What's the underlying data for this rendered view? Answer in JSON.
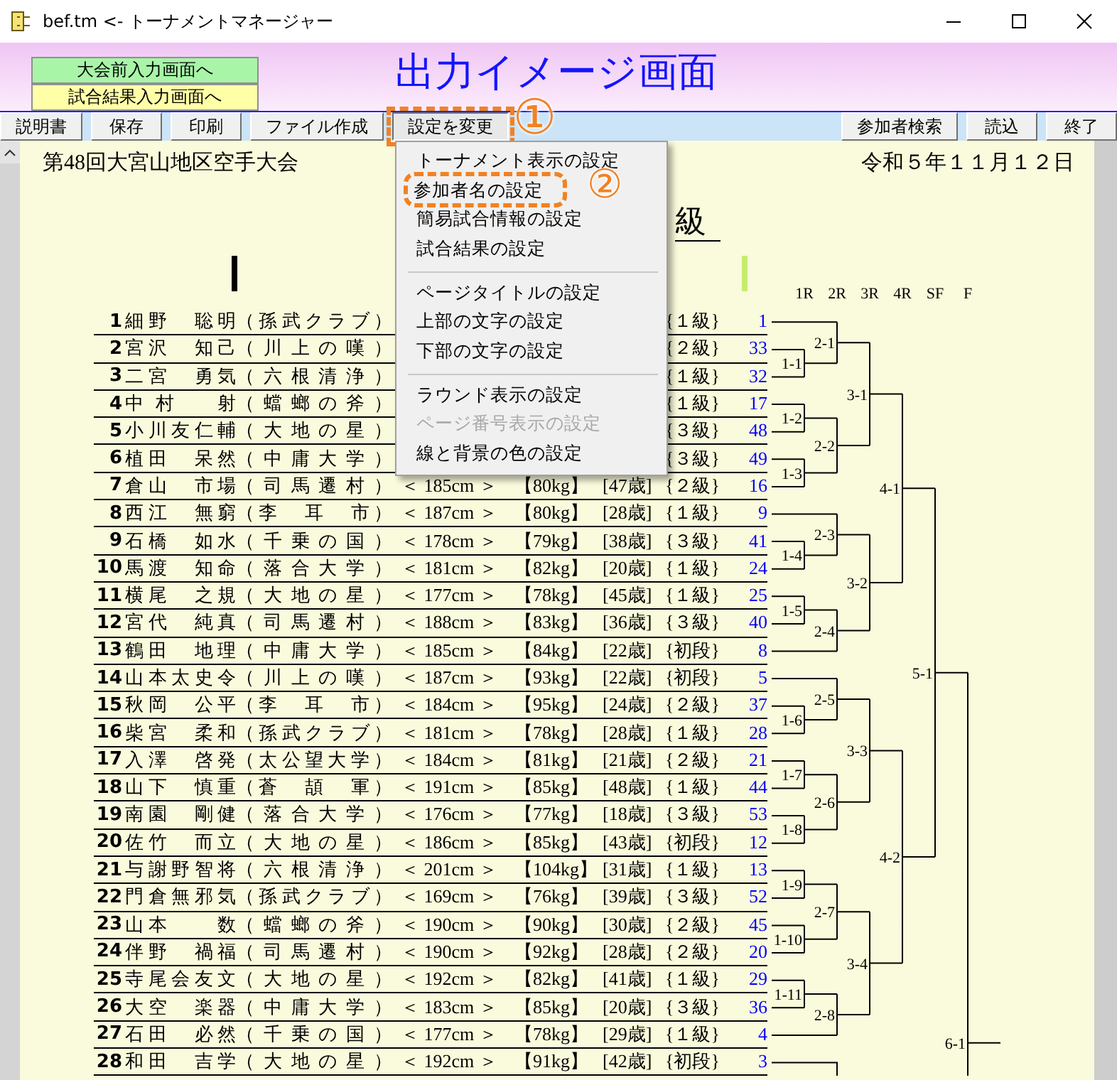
{
  "window": {
    "title": "bef.tm <- トーナメントマネージャー"
  },
  "header": {
    "nav_buttons": [
      {
        "label": "大会前入力画面へ",
        "kind": "green"
      },
      {
        "label": "試合結果入力画面へ",
        "kind": "yellow"
      }
    ],
    "title": "出力イメージ画面"
  },
  "toolbar": {
    "left": [
      {
        "label": "説明書",
        "pressed": false
      },
      {
        "label": "保存",
        "pressed": false
      },
      {
        "label": "印刷",
        "pressed": false
      },
      {
        "label": "ファイル作成",
        "pressed": false
      },
      {
        "label": "設定を変更",
        "pressed": true,
        "callout": "①"
      }
    ],
    "right": [
      {
        "label": "参加者検索",
        "pressed": false
      },
      {
        "label": "読込",
        "pressed": false
      },
      {
        "label": "終了",
        "pressed": false
      }
    ]
  },
  "menu": {
    "items": [
      {
        "kind": "item",
        "label": "トーナメント表示の設定",
        "disabled": false
      },
      {
        "kind": "item",
        "label": "参加者名の設定",
        "disabled": false,
        "callout": "②"
      },
      {
        "kind": "item",
        "label": "簡易試合情報の設定",
        "disabled": false
      },
      {
        "kind": "item",
        "label": "試合結果の設定",
        "disabled": false
      },
      {
        "kind": "separator"
      },
      {
        "kind": "item",
        "label": "ページタイトルの設定",
        "disabled": false
      },
      {
        "kind": "item",
        "label": "上部の文字の設定",
        "disabled": false
      },
      {
        "kind": "item",
        "label": "下部の文字の設定",
        "disabled": false
      },
      {
        "kind": "separator"
      },
      {
        "kind": "item",
        "label": "ラウンド表示の設定",
        "disabled": false
      },
      {
        "kind": "item",
        "label": "ページ番号表示の設定",
        "disabled": true
      },
      {
        "kind": "item",
        "label": "線と背景の色の設定",
        "disabled": false
      }
    ]
  },
  "document": {
    "event_title": "第48回大宮山地区空手大会",
    "date": "令和５年１１月１２日",
    "subtitle": "級",
    "rows": [
      {
        "no": "1",
        "name": "細野　聡明",
        "team": "（孫武クラブ）",
        "grade": "{１級}",
        "seed": "1"
      },
      {
        "no": "2",
        "name": "宮沢　知己",
        "team": "（川上の嘆）",
        "grade": "{２級}",
        "seed": "33"
      },
      {
        "no": "3",
        "name": "二宮　勇気",
        "team": "（六根清浄）",
        "grade": "{１級}",
        "seed": "32"
      },
      {
        "no": "4",
        "name": "中村　射",
        "team": "（蟷螂の斧）",
        "grade": "{１級}",
        "seed": "17"
      },
      {
        "no": "5",
        "name": "小川友仁輔",
        "team": "（大地の星）",
        "grade": "{３級}",
        "seed": "48"
      },
      {
        "no": "6",
        "name": "植田　呆然",
        "team": "（中庸大学）",
        "grade": "{３級}",
        "seed": "49"
      },
      {
        "no": "7",
        "name": "倉山　市場",
        "team": "（司馬遷村）",
        "height": "＜ 185cm ＞",
        "weight": "【80kg】",
        "age": "[47歳]",
        "grade": "{２級}",
        "seed": "16"
      },
      {
        "no": "8",
        "name": "西江　無窮",
        "team": "（李　耳　市）",
        "height": "＜ 187cm ＞",
        "weight": "【80kg】",
        "age": "[28歳]",
        "grade": "{１級}",
        "seed": "9"
      },
      {
        "no": "9",
        "name": "石橋　如水",
        "team": "（千乗の国）",
        "height": "＜ 178cm ＞",
        "weight": "【79kg】",
        "age": "[38歳]",
        "grade": "{３級}",
        "seed": "41"
      },
      {
        "no": "10",
        "name": "馬渡　知命",
        "team": "（落合大学）",
        "height": "＜ 181cm ＞",
        "weight": "【82kg】",
        "age": "[20歳]",
        "grade": "{１級}",
        "seed": "24"
      },
      {
        "no": "11",
        "name": "横尾　之規",
        "team": "（大地の星）",
        "height": "＜ 177cm ＞",
        "weight": "【78kg】",
        "age": "[45歳]",
        "grade": "{１級}",
        "seed": "25"
      },
      {
        "no": "12",
        "name": "宮代　純真",
        "team": "（司馬遷村）",
        "height": "＜ 188cm ＞",
        "weight": "【83kg】",
        "age": "[36歳]",
        "grade": "{３級}",
        "seed": "40"
      },
      {
        "no": "13",
        "name": "鶴田　地理",
        "team": "（中庸大学）",
        "height": "＜ 185cm ＞",
        "weight": "【84kg】",
        "age": "[22歳]",
        "grade": "{初段}",
        "seed": "8"
      },
      {
        "no": "14",
        "name": "山本太史令",
        "team": "（川上の嘆）",
        "height": "＜ 187cm ＞",
        "weight": "【93kg】",
        "age": "[22歳]",
        "grade": "{初段}",
        "seed": "5"
      },
      {
        "no": "15",
        "name": "秋岡　公平",
        "team": "（李　耳　市）",
        "height": "＜ 184cm ＞",
        "weight": "【95kg】",
        "age": "[24歳]",
        "grade": "{２級}",
        "seed": "37"
      },
      {
        "no": "16",
        "name": "柴宮　柔和",
        "team": "（孫武クラブ）",
        "height": "＜ 181cm ＞",
        "weight": "【78kg】",
        "age": "[28歳]",
        "grade": "{１級}",
        "seed": "28"
      },
      {
        "no": "17",
        "name": "入澤　啓発",
        "team": "（太公望大学）",
        "height": "＜ 184cm ＞",
        "weight": "【81kg】",
        "age": "[21歳]",
        "grade": "{２級}",
        "seed": "21"
      },
      {
        "no": "18",
        "name": "山下　慎重",
        "team": "（蒼　頡　軍）",
        "height": "＜ 191cm ＞",
        "weight": "【85kg】",
        "age": "[48歳]",
        "grade": "{１級}",
        "seed": "44"
      },
      {
        "no": "19",
        "name": "南園　剛健",
        "team": "（落合大学）",
        "height": "＜ 176cm ＞",
        "weight": "【77kg】",
        "age": "[18歳]",
        "grade": "{３級}",
        "seed": "53"
      },
      {
        "no": "20",
        "name": "佐竹　而立",
        "team": "（大地の星）",
        "height": "＜ 186cm ＞",
        "weight": "【85kg】",
        "age": "[43歳]",
        "grade": "{初段}",
        "seed": "12"
      },
      {
        "no": "21",
        "name": "与謝野智将",
        "team": "（六根清浄）",
        "height": "＜ 201cm ＞",
        "weight": "【104kg】",
        "age": "[31歳]",
        "grade": "{１級}",
        "seed": "13"
      },
      {
        "no": "22",
        "name": "門倉無邪気",
        "team": "（孫武クラブ）",
        "height": "＜ 169cm ＞",
        "weight": "【76kg】",
        "age": "[39歳]",
        "grade": "{３級}",
        "seed": "52"
      },
      {
        "no": "23",
        "name": "山本　　数",
        "team": "（蟷螂の斧）",
        "height": "＜ 190cm ＞",
        "weight": "【90kg】",
        "age": "[30歳]",
        "grade": "{２級}",
        "seed": "45"
      },
      {
        "no": "24",
        "name": "伴野　禍福",
        "team": "（司馬遷村）",
        "height": "＜ 190cm ＞",
        "weight": "【92kg】",
        "age": "[28歳]",
        "grade": "{２級}",
        "seed": "20"
      },
      {
        "no": "25",
        "name": "寺尾会友文",
        "team": "（大地の星）",
        "height": "＜ 192cm ＞",
        "weight": "【82kg】",
        "age": "[41歳]",
        "grade": "{１級}",
        "seed": "29"
      },
      {
        "no": "26",
        "name": "大空　楽器",
        "team": "（中庸大学）",
        "height": "＜ 183cm ＞",
        "weight": "【85kg】",
        "age": "[20歳]",
        "grade": "{３級}",
        "seed": "36"
      },
      {
        "no": "27",
        "name": "石田　必然",
        "team": "（千乗の国）",
        "height": "＜ 177cm ＞",
        "weight": "【78kg】",
        "age": "[29歳]",
        "grade": "{１級}",
        "seed": "4"
      },
      {
        "no": "28",
        "name": "和田　吉学",
        "team": "（大地の星）",
        "height": "＜ 192cm ＞",
        "weight": "【91kg】",
        "age": "[42歳]",
        "grade": "{初段}",
        "seed": "3"
      }
    ]
  },
  "bracket": {
    "rounds": [
      "1R",
      "2R",
      "3R",
      "4R",
      "SF",
      "F"
    ],
    "tree": {
      "kind": "match",
      "label": "6-1",
      "children": [
        {
          "kind": "match",
          "label": "5-1",
          "children": [
            {
              "kind": "match",
              "label": "4-1",
              "children": [
                {
                  "kind": "match",
                  "label": "3-1",
                  "children": [
                    {
                      "kind": "match",
                      "label": "2-1",
                      "children": [
                        {
                          "kind": "player"
                        },
                        {
                          "kind": "match",
                          "label": "1-1",
                          "children": [
                            {
                              "kind": "player"
                            },
                            {
                              "kind": "player"
                            }
                          ]
                        }
                      ]
                    },
                    {
                      "kind": "match",
                      "label": "2-2",
                      "children": [
                        {
                          "kind": "match",
                          "label": "1-2",
                          "children": [
                            {
                              "kind": "player"
                            },
                            {
                              "kind": "player"
                            }
                          ]
                        },
                        {
                          "kind": "match",
                          "label": "1-3",
                          "children": [
                            {
                              "kind": "player"
                            },
                            {
                              "kind": "player"
                            }
                          ]
                        }
                      ]
                    }
                  ]
                },
                {
                  "kind": "match",
                  "label": "3-2",
                  "children": [
                    {
                      "kind": "match",
                      "label": "2-3",
                      "children": [
                        {
                          "kind": "player"
                        },
                        {
                          "kind": "match",
                          "label": "1-4",
                          "children": [
                            {
                              "kind": "player"
                            },
                            {
                              "kind": "player"
                            }
                          ]
                        }
                      ]
                    },
                    {
                      "kind": "match",
                      "label": "2-4",
                      "children": [
                        {
                          "kind": "match",
                          "label": "1-5",
                          "children": [
                            {
                              "kind": "player"
                            },
                            {
                              "kind": "player"
                            }
                          ]
                        },
                        {
                          "kind": "player"
                        }
                      ]
                    }
                  ]
                }
              ]
            },
            {
              "kind": "match",
              "label": "4-2",
              "children": [
                {
                  "kind": "match",
                  "label": "3-3",
                  "children": [
                    {
                      "kind": "match",
                      "label": "2-5",
                      "children": [
                        {
                          "kind": "player"
                        },
                        {
                          "kind": "match",
                          "label": "1-6",
                          "children": [
                            {
                              "kind": "player"
                            },
                            {
                              "kind": "player"
                            }
                          ]
                        }
                      ]
                    },
                    {
                      "kind": "match",
                      "label": "2-6",
                      "children": [
                        {
                          "kind": "match",
                          "label": "1-7",
                          "children": [
                            {
                              "kind": "player"
                            },
                            {
                              "kind": "player"
                            }
                          ]
                        },
                        {
                          "kind": "match",
                          "label": "1-8",
                          "children": [
                            {
                              "kind": "player"
                            },
                            {
                              "kind": "player"
                            }
                          ]
                        }
                      ]
                    }
                  ]
                },
                {
                  "kind": "match",
                  "label": "3-4",
                  "children": [
                    {
                      "kind": "match",
                      "label": "2-7",
                      "children": [
                        {
                          "kind": "match",
                          "label": "1-9",
                          "children": [
                            {
                              "kind": "player"
                            },
                            {
                              "kind": "player"
                            }
                          ]
                        },
                        {
                          "kind": "match",
                          "label": "1-10",
                          "children": [
                            {
                              "kind": "player"
                            },
                            {
                              "kind": "player"
                            }
                          ]
                        }
                      ]
                    },
                    {
                      "kind": "match",
                      "label": "2-8",
                      "children": [
                        {
                          "kind": "match",
                          "label": "1-11",
                          "children": [
                            {
                              "kind": "player"
                            },
                            {
                              "kind": "player"
                            }
                          ]
                        },
                        {
                          "kind": "player"
                        }
                      ]
                    }
                  ]
                }
              ]
            }
          ]
        },
        {
          "kind": "continued"
        }
      ]
    }
  }
}
